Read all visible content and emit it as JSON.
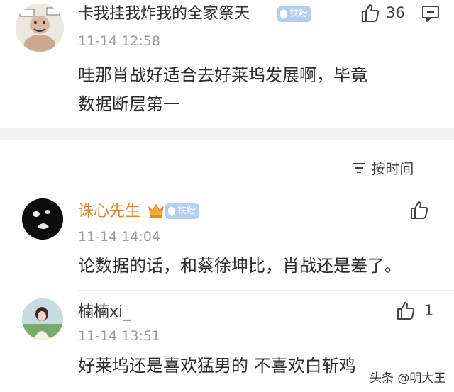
{
  "top_comment": {
    "username": "卡我挂我炸我的全家祭天",
    "badge": "铁粉",
    "time": "11-14 12:58",
    "text_lines": [
      "哇那肖战好适合去好莱坞发展啊，毕竟",
      "数据断层第一"
    ],
    "likes": "36"
  },
  "sort": {
    "label": "按时间"
  },
  "replies": [
    {
      "username": "诛心先生",
      "username_color": "#e4842c",
      "badge": "铁粉",
      "time": "11-14 14:04",
      "text": "论数据的话，和蔡徐坤比，肖战还是差了。",
      "likes": ""
    },
    {
      "username": "楠楠xi_",
      "username_color": "#333333",
      "time": "11-14 13:51",
      "text": "好莱坞还是喜欢猛男的 不喜欢白斩鸡",
      "likes": "1"
    }
  ],
  "watermark": "头条 @明大王",
  "icons": [
    "thumbs-up-icon",
    "comment-icon",
    "sort-icon",
    "fan-badge-icon",
    "crown-badge-icon"
  ]
}
